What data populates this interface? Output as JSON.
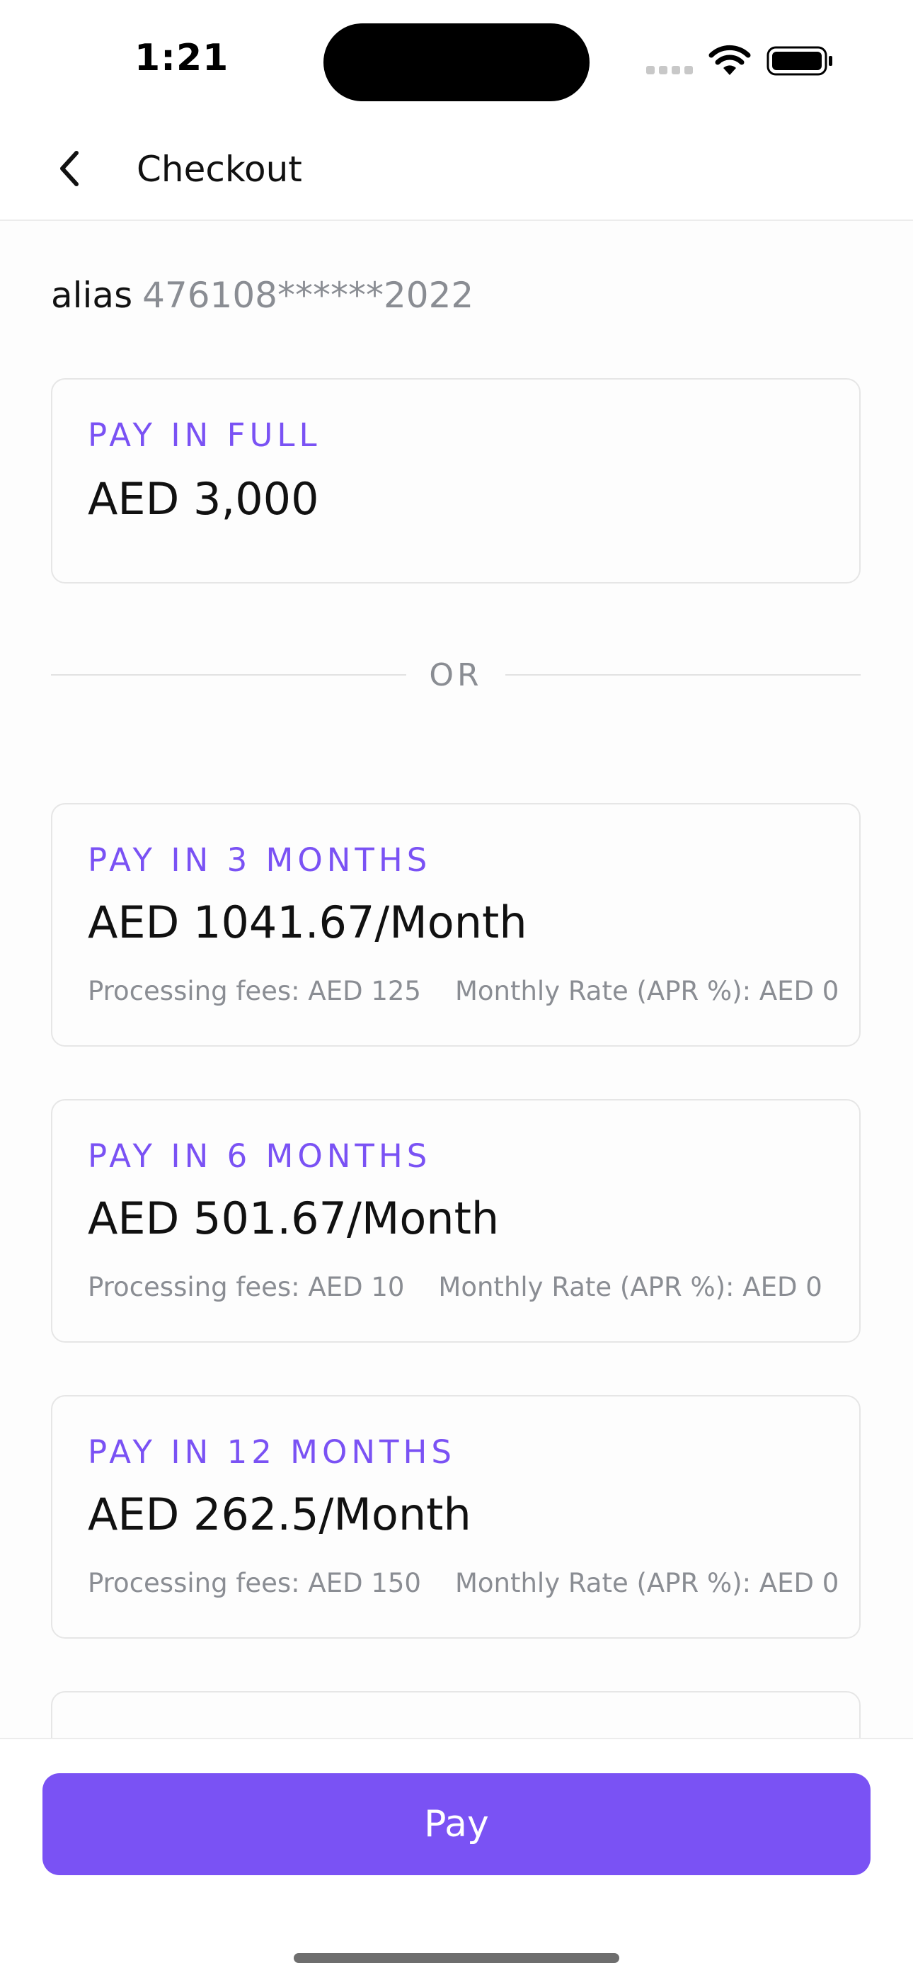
{
  "status_bar": {
    "time": "1:21"
  },
  "nav": {
    "title": "Checkout"
  },
  "alias": {
    "label": "alias",
    "value": "476108******2022"
  },
  "pay_in_full": {
    "tag": "PAY IN FULL",
    "amount": "AED 3,000"
  },
  "divider": {
    "text": "OR"
  },
  "plans": [
    {
      "tag": "PAY IN 3 MONTHS",
      "amount": "AED 1041.67/Month",
      "processing_fees": "Processing fees: AED 125",
      "monthly_rate": "Monthly Rate (APR %): AED 0"
    },
    {
      "tag": "PAY IN 6 MONTHS",
      "amount": "AED 501.67/Month",
      "processing_fees": "Processing fees: AED 10",
      "monthly_rate": "Monthly Rate (APR %): AED 0"
    },
    {
      "tag": "PAY IN 12 MONTHS",
      "amount": "AED 262.5/Month",
      "processing_fees": "Processing fees: AED 150",
      "monthly_rate": "Monthly Rate (APR %): AED 0"
    }
  ],
  "footer": {
    "pay_label": "Pay"
  },
  "colors": {
    "accent": "#7a52f4",
    "muted_text": "#8a8d93",
    "card_border": "#e6e6e6"
  }
}
